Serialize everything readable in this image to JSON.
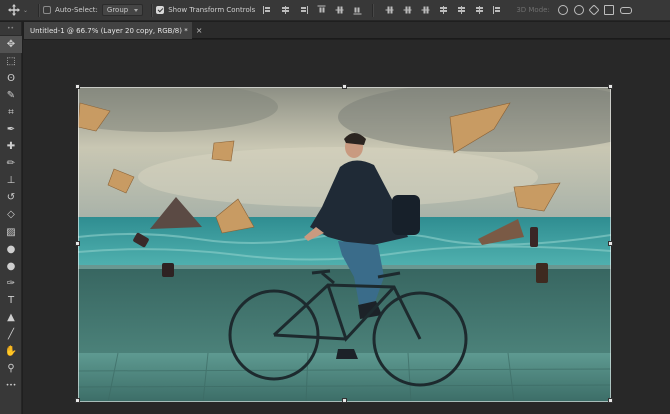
{
  "options_bar": {
    "auto_select_label": "Auto-Select:",
    "auto_select_checked": false,
    "auto_select_target": "Group",
    "show_transform_label": "Show Transform Controls",
    "show_transform_checked": true,
    "mode_3d_label": "3D Mode:"
  },
  "document_tab": {
    "title": "Untitled-1 @ 66.7% (Layer 20 copy, RGB/8) *",
    "close_glyph": "×"
  },
  "toolbar": {
    "grip": "••",
    "tools": [
      {
        "name": "move-tool",
        "glyph": "✥",
        "active": true
      },
      {
        "name": "marquee-tool",
        "glyph": "⬚"
      },
      {
        "name": "lasso-tool",
        "glyph": "ʘ"
      },
      {
        "name": "quick-select-tool",
        "glyph": "✎"
      },
      {
        "name": "crop-tool",
        "glyph": "⌗"
      },
      {
        "name": "eyedropper-tool",
        "glyph": "✒"
      },
      {
        "name": "healing-brush-tool",
        "glyph": "✚"
      },
      {
        "name": "brush-tool",
        "glyph": "✏"
      },
      {
        "name": "clone-stamp-tool",
        "glyph": "⊥"
      },
      {
        "name": "history-brush-tool",
        "glyph": "↺"
      },
      {
        "name": "eraser-tool",
        "glyph": "◇"
      },
      {
        "name": "gradient-tool",
        "glyph": "▨"
      },
      {
        "name": "blur-tool",
        "glyph": "●"
      },
      {
        "name": "dodge-tool",
        "glyph": "●"
      },
      {
        "name": "pen-tool",
        "glyph": "✑"
      },
      {
        "name": "type-tool",
        "glyph": "T"
      },
      {
        "name": "path-select-tool",
        "glyph": "▲"
      },
      {
        "name": "line-tool",
        "glyph": "╱"
      },
      {
        "name": "hand-tool",
        "glyph": "✋"
      },
      {
        "name": "zoom-tool",
        "glyph": "⚲"
      },
      {
        "name": "more-tools",
        "glyph": "•••"
      }
    ]
  },
  "colors": {
    "panel": "#383838",
    "workspace": "#282828",
    "sky": "#b4b6a4",
    "sea": "#3f9a9c",
    "grass": "#3e6a64",
    "pavement": "#5f9a92"
  }
}
